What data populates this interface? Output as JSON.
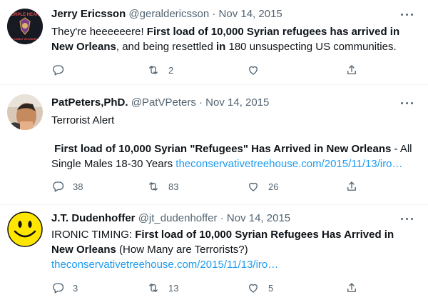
{
  "tweets": [
    {
      "name": "Jerry Ericsson",
      "handle": "@geraldericsson",
      "sep": "·",
      "date": "Nov 14, 2015",
      "avatar_text": "PURPLE HEART",
      "avatar_sub": "COMBAT WOUNDED",
      "text": [
        {
          "t": "They're heeeeeere! ",
          "b": false
        },
        {
          "t": "First load of 10,000 Syrian refugees has arrived in New Orleans",
          "b": true
        },
        {
          "t": ", and being resettled ",
          "b": false
        },
        {
          "t": "in",
          "b": true
        },
        {
          "t": " 180 unsuspecting US communities.",
          "b": false
        }
      ],
      "counts": {
        "reply": "",
        "retweet": "2",
        "like": "",
        "share": ""
      }
    },
    {
      "name": "PatPeters,PhD.",
      "handle": "@PatVPeters",
      "sep": "·",
      "date": "Nov 14, 2015",
      "line1": "Terrorist Alert",
      "headline": "First load of 10,000 Syrian \"Refugees\" Has Arrived in New Orleans",
      "rest": " - All Single Males 18-30 Years ",
      "link": "theconservativetreehouse.com/2015/11/13/iro…",
      "counts": {
        "reply": "38",
        "retweet": "83",
        "like": "26",
        "share": ""
      }
    },
    {
      "name": "J.T. Dudenhoffer",
      "handle": "@jt_dudenhoffer",
      "sep": "·",
      "date": "Nov 14, 2015",
      "prefix": "IRONIC TIMING: ",
      "headline": "First load of 10,000 Syrian Refugees Has Arrived in New Orleans",
      "suffix": " (How Many are Terrorists?)",
      "link": "theconservativetreehouse.com/2015/11/13/iro…",
      "counts": {
        "reply": "3",
        "retweet": "13",
        "like": "5",
        "share": ""
      }
    }
  ],
  "icons": {
    "reply": "reply-icon",
    "retweet": "retweet-icon",
    "like": "heart-icon",
    "share": "share-icon",
    "more": "more-icon"
  },
  "colors": {
    "text": "#0f1419",
    "muted": "#536471",
    "link": "#1d9bf0",
    "divider": "#eff3f4"
  }
}
